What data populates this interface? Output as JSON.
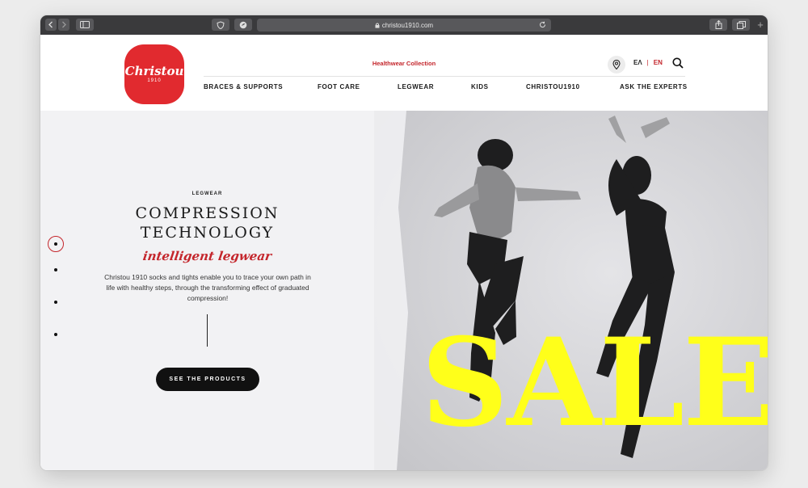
{
  "browser": {
    "url": "christou1910.com",
    "icons": {
      "back": "chevron-left-icon",
      "forward": "chevron-right-icon",
      "sidebar": "sidebar-icon",
      "shield": "shield-icon",
      "extension": "bird-icon",
      "reload": "reload-icon",
      "share": "share-icon",
      "tabs": "tabs-icon"
    }
  },
  "header": {
    "logo_text": "Christou",
    "logo_year": "1910",
    "collection_label": "Healthwear Collection",
    "languages": [
      "ΕΛ",
      "EN"
    ],
    "active_language": "EN",
    "nav": [
      "BRACES & SUPPORTS",
      "FOOT CARE",
      "LEGWEAR",
      "KIDS",
      "CHRISTOU1910",
      "ASK THE EXPERTS"
    ]
  },
  "hero": {
    "eyebrow": "LEGWEAR",
    "headline_line1": "COMPRESSION",
    "headline_line2": "TECHNOLOGY",
    "tagline": "intelligent legwear",
    "description": "Christou 1910 socks and tights enable you to trace your own path in life with healthy steps, through the transforming effect of graduated compression!",
    "cta": "SEE THE PRODUCTS",
    "image_text": "SALE",
    "slide_count": 4,
    "active_slide": 1
  },
  "colors": {
    "brand_red": "#e12a2f",
    "accent_red": "#c4262c",
    "sale_yellow": "#ffff1a",
    "toolbar": "#3a3a3c"
  }
}
